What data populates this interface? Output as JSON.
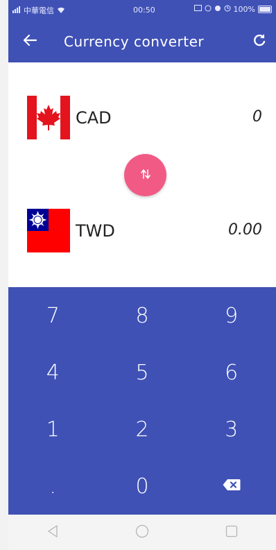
{
  "status_bar": {
    "carrier": "中華電信",
    "time": "00:50",
    "battery_text": "100%",
    "icons": [
      "signal-icon",
      "wifi-icon",
      "cast-icon",
      "rotate-icon",
      "location-icon",
      "alarm-icon",
      "battery-icon"
    ]
  },
  "appbar": {
    "title": "Currency converter",
    "back_icon": "arrow-back-icon",
    "refresh_icon": "refresh-icon",
    "color": "#3f51b5"
  },
  "from_currency": {
    "code": "CAD",
    "amount": "0",
    "flag": "canada-flag"
  },
  "to_currency": {
    "code": "TWD",
    "amount": "0.00",
    "flag": "taiwan-flag"
  },
  "swap_button": {
    "icon": "swap-vertical-icon",
    "color": "#f25a86"
  },
  "keypad": {
    "keys": [
      "7",
      "8",
      "9",
      "4",
      "5",
      "6",
      "1",
      "2",
      "3",
      ".",
      "0"
    ],
    "delete_icon": "backspace-icon",
    "color": "#3f51b5"
  },
  "navbar": {
    "icons": [
      "back-triangle-icon",
      "home-circle-icon",
      "recents-square-icon"
    ]
  }
}
